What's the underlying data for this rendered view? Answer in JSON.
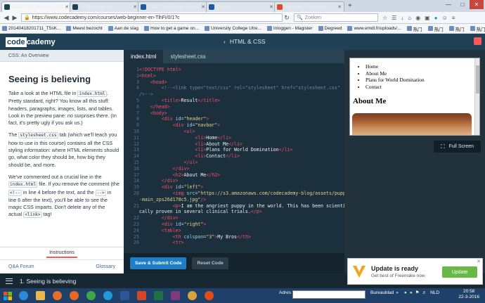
{
  "browser": {
    "tabs": [
      {
        "label": "CSS: An Overview | Codeca...",
        "icon": "codecademy-favicon-icon",
        "color": "#204056",
        "active": true
      },
      {
        "label": "| Codecademy",
        "icon": "codecademy-favicon-icon",
        "color": "#204056"
      },
      {
        "label": "CSS Color Module Level 3",
        "icon": "w3c-favicon-icon",
        "color": "#1d5aa0"
      },
      {
        "label": "Fonts",
        "icon": "w3c-favicon-icon",
        "color": "#1d5aa0"
      },
      {
        "label": "Agenda - Magister",
        "icon": "magister-favicon-icon",
        "color": "#d94c2a"
      }
    ],
    "url": "https://www.codecademy.com/courses/web-beginner-en-TlhFi/0/1?c",
    "search_placeholder": "Zoeken",
    "bookmarks": [
      "20140418201711_T5sK...",
      "Meest bezocht",
      "Aan de slag",
      "How to get a game on...",
      "University College Utre...",
      "Inloggen - Magister",
      "Degreed",
      "www.emdl.fr/uploads/...",
      "热门",
      "热门",
      "热门",
      "热门",
      "热门",
      "热门"
    ]
  },
  "header": {
    "logo_left": "code",
    "logo_right": "cademy",
    "center_title": "HTML & CSS"
  },
  "lesson": {
    "breadcrumb": "CSS: An Overview",
    "title": "Seeing is believing",
    "p1_a": "Take a look at the HTML file in ",
    "p1_code": "index.html",
    "p1_b": ". Pretty standard, right? You know all this stuff: headers, paragraphs, images, lists, and tables. Look in the preview pane: no surprises there. (In fact, it's pretty ugly if you ask us.)",
    "p2_a": "The ",
    "p2_code": "stylesheet.css",
    "p2_b": " tab (which we'll teach you how to use in this course) contains all the CSS styling information: where HTML elements should go, what color they should be, how big they should be, and more.",
    "p3_a": "We've commented out a crucial line in the ",
    "p3_code1": "index.html",
    "p3_b": " file. If you remove the comment (the ",
    "p3_code2": "<!--",
    "p3_c": " in line 4 before the text, and the ",
    "p3_code3": "-->",
    "p3_d": " in line 6 after the text), you'll be able to see the magic CSS imparts. Don't delete any of the actual ",
    "p3_code4": "<link>",
    "p3_e": " tag!",
    "instructions_label": "Instructions",
    "qa_forum": "Q&A Forum",
    "glossary": "Glossary"
  },
  "editor": {
    "tabs": [
      "index.html",
      "stylesheet.css"
    ],
    "lines": [
      {
        "n": "1",
        "html": "<span class='tg'>&lt;!DOCTYPE html&gt;</span>"
      },
      {
        "n": "2",
        "html": "<span class='tg'>&lt;html&gt;</span>"
      },
      {
        "n": "3",
        "html": "    <span class='tg'>&lt;head&gt;</span>"
      },
      {
        "n": "4",
        "html": "        <span class='cm'>&lt;!--&lt;link type=\"text/css\" rel=\"stylesheet\" href=\"stylesheet.css\"</span>"
      },
      {
        "n": "",
        "html": "<span class='cm'>/&gt;--&gt;</span>"
      },
      {
        "n": "5",
        "html": "        <span class='tg'>&lt;title&gt;</span><span class='tx'>Result</span><span class='tg'>&lt;/title&gt;</span>"
      },
      {
        "n": "6",
        "html": "    <span class='tg'>&lt;/head&gt;</span>"
      },
      {
        "n": "7",
        "html": "    <span class='tg'>&lt;body&gt;</span>"
      },
      {
        "n": "8",
        "html": "        <span class='tg'>&lt;div</span> <span class='at'>id</span>=<span class='st'>\"header\"</span><span class='tg'>&gt;</span>"
      },
      {
        "n": "9",
        "html": "            <span class='tg'>&lt;div</span> <span class='at'>id</span>=<span class='st'>\"navbar\"</span><span class='tg'>&gt;</span>"
      },
      {
        "n": "10",
        "html": "                <span class='tg'>&lt;ul&gt;</span>"
      },
      {
        "n": "11",
        "html": "                    <span class='tg'>&lt;li&gt;</span><span class='tx'>Home</span><span class='tg'>&lt;/li&gt;</span>"
      },
      {
        "n": "12",
        "html": "                    <span class='tg'>&lt;li&gt;</span><span class='tx'>About Me</span><span class='tg'>&lt;/li&gt;</span>"
      },
      {
        "n": "13",
        "html": "                    <span class='tg'>&lt;li&gt;</span><span class='tx'>Plans for World Domination</span><span class='tg'>&lt;/li&gt;</span>"
      },
      {
        "n": "14",
        "html": "                    <span class='tg'>&lt;li&gt;</span><span class='tx'>Contact</span><span class='tg'>&lt;/li&gt;</span>"
      },
      {
        "n": "15",
        "html": "                <span class='tg'>&lt;/ul&gt;</span>"
      },
      {
        "n": "16",
        "html": "            <span class='tg'>&lt;/div&gt;</span>"
      },
      {
        "n": "17",
        "html": "            <span class='tg'>&lt;h2&gt;</span><span class='tx'>About Me</span><span class='tg'>&lt;/h2&gt;</span>"
      },
      {
        "n": "18",
        "html": "        <span class='tg'>&lt;/div&gt;</span>"
      },
      {
        "n": "19",
        "html": "        <span class='tg'>&lt;div</span> <span class='at'>id</span>=<span class='st'>\"left\"</span><span class='tg'>&gt;</span>"
      },
      {
        "n": "20",
        "html": "            <span class='tg'>&lt;img</span> <span class='at'>src</span>=<span class='st'>\"https://s3.amazonaws.com/codecademy-blog/assets/puppy</span>"
      },
      {
        "n": "",
        "html": "<span class='st'>-main_zps26d178c5.jpg\"</span><span class='tg'>/&gt;</span>"
      },
      {
        "n": "21",
        "html": "            <span class='tg'>&lt;p&gt;</span><span class='tx'>I am the angriest puppy in the world. This has been scientifi</span>"
      },
      {
        "n": "",
        "html": "<span class='tx'>cally proven in several clinical trials.</span><span class='tg'>&lt;/p&gt;</span>"
      },
      {
        "n": "22",
        "html": "        <span class='tg'>&lt;/div&gt;</span>"
      },
      {
        "n": "23",
        "html": "        <span class='tg'>&lt;div</span> <span class='at'>id</span>=<span class='st'>\"right\"</span><span class='tg'>&gt;</span>"
      },
      {
        "n": "24",
        "html": "        <span class='tg'>&lt;table&gt;</span>"
      },
      {
        "n": "25",
        "html": "            <span class='tg'>&lt;th</span> <span class='at'>colspan</span>=<span class='st'>\"3\"</span><span class='tg'>&gt;</span><span class='tx'>My Bros</span><span class='tg'>&lt;/th&gt;</span>"
      },
      {
        "n": "26",
        "html": "            <span class='tg'>&lt;tr&gt;</span>"
      }
    ],
    "submit_label": "Save & Submit Code",
    "reset_label": "Reset Code"
  },
  "preview": {
    "nav_items": [
      "Home",
      "About Me",
      "Plans for World Domination",
      "Contact"
    ],
    "heading": "About Me",
    "fullscreen_label": "Full Screen"
  },
  "popup": {
    "title": "Update is ready",
    "subtitle": "Get best of Freemake now",
    "button": "Update"
  },
  "lesson_bar": {
    "label": "1. Seeing is believing"
  },
  "taskbar": {
    "address_label": "Adres",
    "tray_label": "Bureaublad",
    "lang": "NLD",
    "time": "20:58",
    "date": "22-3-2016"
  }
}
